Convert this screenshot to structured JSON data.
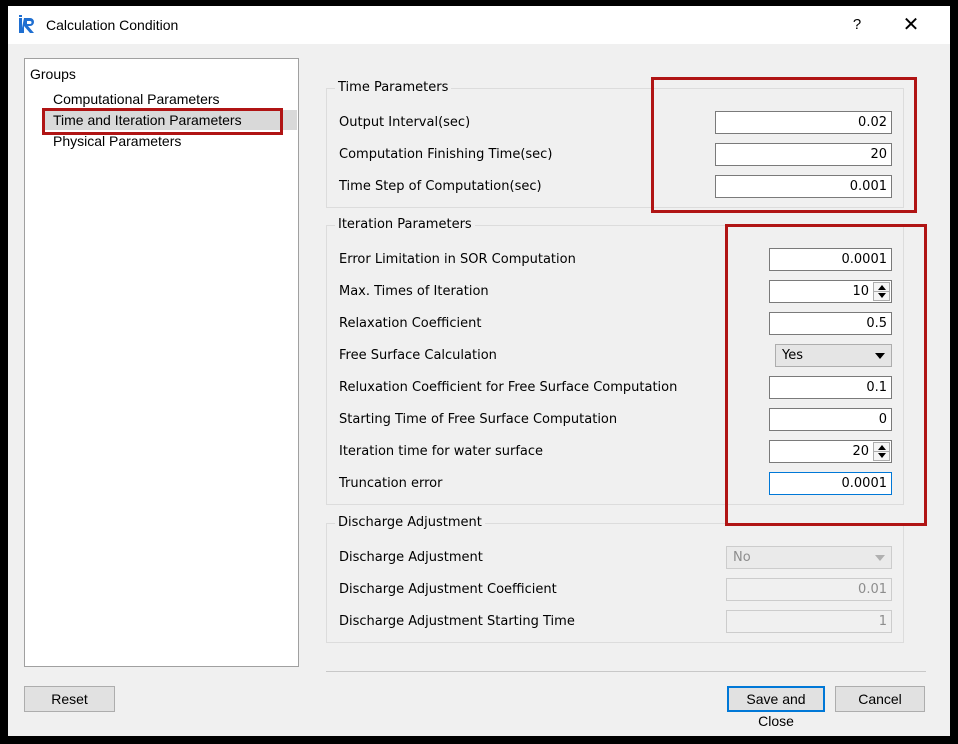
{
  "window": {
    "title": "Calculation Condition",
    "help": "?",
    "close": "✕"
  },
  "groups": {
    "root": "Groups",
    "items": [
      "Computational Parameters",
      "Time and Iteration Parameters",
      "Physical Parameters"
    ]
  },
  "time_params": {
    "title": "Time Parameters",
    "output_interval": {
      "label": "Output Interval(sec)",
      "value": "0.02"
    },
    "finishing_time": {
      "label": "Computation Finishing Time(sec)",
      "value": "20"
    },
    "time_step": {
      "label": "Time Step of Computation(sec)",
      "value": "0.001"
    }
  },
  "iteration_params": {
    "title": "Iteration Parameters",
    "error_limit": {
      "label": "Error Limitation in SOR Computation",
      "value": "0.0001"
    },
    "max_times": {
      "label": "Max. Times of Iteration",
      "value": "10"
    },
    "relaxation": {
      "label": "Relaxation Coefficient",
      "value": "0.5"
    },
    "free_surface": {
      "label": "Free Surface Calculation",
      "value": "Yes"
    },
    "reluxation_fs": {
      "label": "Reluxation Coefficient for Free Surface Computation",
      "value": "0.1"
    },
    "start_fs": {
      "label": "Starting Time of Free Surface Computation",
      "value": "0"
    },
    "iter_water": {
      "label": "Iteration time for water surface",
      "value": "20"
    },
    "truncation": {
      "label": "Truncation error",
      "value": "0.0001"
    }
  },
  "discharge": {
    "title": "Discharge Adjustment",
    "adjustment": {
      "label": "Discharge Adjustment",
      "value": "No"
    },
    "coefficient": {
      "label": "Discharge Adjustment Coefficient",
      "value": "0.01"
    },
    "starting": {
      "label": "Discharge Adjustment Starting Time",
      "value": "1"
    }
  },
  "buttons": {
    "reset": "Reset",
    "save": "Save and Close",
    "cancel": "Cancel"
  },
  "colors": {
    "highlight_box": "#b01414",
    "focus": "#0078d7",
    "selected_item": "#d9d9d9"
  }
}
